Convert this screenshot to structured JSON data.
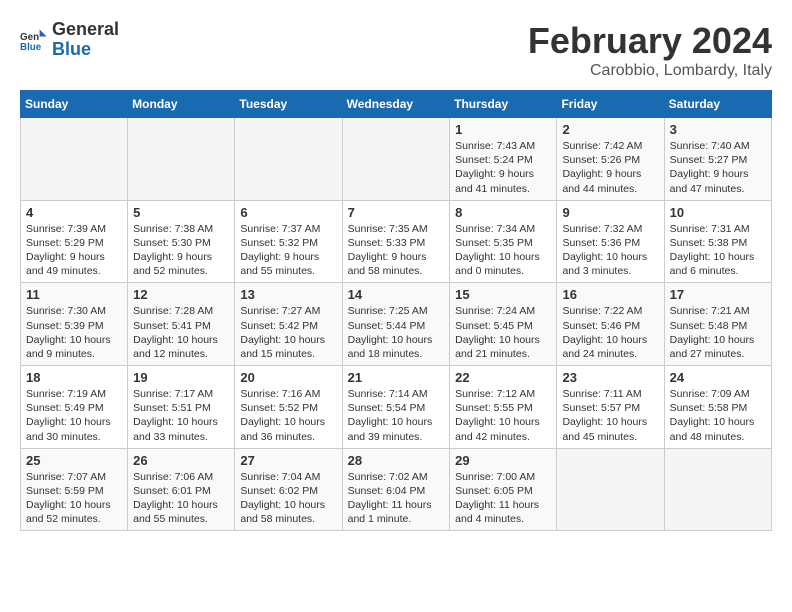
{
  "logo": {
    "line1": "General",
    "line2": "Blue"
  },
  "calendar": {
    "title": "February 2024",
    "subtitle": "Carobbio, Lombardy, Italy"
  },
  "headers": [
    "Sunday",
    "Monday",
    "Tuesday",
    "Wednesday",
    "Thursday",
    "Friday",
    "Saturday"
  ],
  "weeks": [
    [
      {
        "day": "",
        "info": ""
      },
      {
        "day": "",
        "info": ""
      },
      {
        "day": "",
        "info": ""
      },
      {
        "day": "",
        "info": ""
      },
      {
        "day": "1",
        "info": "Sunrise: 7:43 AM\nSunset: 5:24 PM\nDaylight: 9 hours\nand 41 minutes."
      },
      {
        "day": "2",
        "info": "Sunrise: 7:42 AM\nSunset: 5:26 PM\nDaylight: 9 hours\nand 44 minutes."
      },
      {
        "day": "3",
        "info": "Sunrise: 7:40 AM\nSunset: 5:27 PM\nDaylight: 9 hours\nand 47 minutes."
      }
    ],
    [
      {
        "day": "4",
        "info": "Sunrise: 7:39 AM\nSunset: 5:29 PM\nDaylight: 9 hours\nand 49 minutes."
      },
      {
        "day": "5",
        "info": "Sunrise: 7:38 AM\nSunset: 5:30 PM\nDaylight: 9 hours\nand 52 minutes."
      },
      {
        "day": "6",
        "info": "Sunrise: 7:37 AM\nSunset: 5:32 PM\nDaylight: 9 hours\nand 55 minutes."
      },
      {
        "day": "7",
        "info": "Sunrise: 7:35 AM\nSunset: 5:33 PM\nDaylight: 9 hours\nand 58 minutes."
      },
      {
        "day": "8",
        "info": "Sunrise: 7:34 AM\nSunset: 5:35 PM\nDaylight: 10 hours\nand 0 minutes."
      },
      {
        "day": "9",
        "info": "Sunrise: 7:32 AM\nSunset: 5:36 PM\nDaylight: 10 hours\nand 3 minutes."
      },
      {
        "day": "10",
        "info": "Sunrise: 7:31 AM\nSunset: 5:38 PM\nDaylight: 10 hours\nand 6 minutes."
      }
    ],
    [
      {
        "day": "11",
        "info": "Sunrise: 7:30 AM\nSunset: 5:39 PM\nDaylight: 10 hours\nand 9 minutes."
      },
      {
        "day": "12",
        "info": "Sunrise: 7:28 AM\nSunset: 5:41 PM\nDaylight: 10 hours\nand 12 minutes."
      },
      {
        "day": "13",
        "info": "Sunrise: 7:27 AM\nSunset: 5:42 PM\nDaylight: 10 hours\nand 15 minutes."
      },
      {
        "day": "14",
        "info": "Sunrise: 7:25 AM\nSunset: 5:44 PM\nDaylight: 10 hours\nand 18 minutes."
      },
      {
        "day": "15",
        "info": "Sunrise: 7:24 AM\nSunset: 5:45 PM\nDaylight: 10 hours\nand 21 minutes."
      },
      {
        "day": "16",
        "info": "Sunrise: 7:22 AM\nSunset: 5:46 PM\nDaylight: 10 hours\nand 24 minutes."
      },
      {
        "day": "17",
        "info": "Sunrise: 7:21 AM\nSunset: 5:48 PM\nDaylight: 10 hours\nand 27 minutes."
      }
    ],
    [
      {
        "day": "18",
        "info": "Sunrise: 7:19 AM\nSunset: 5:49 PM\nDaylight: 10 hours\nand 30 minutes."
      },
      {
        "day": "19",
        "info": "Sunrise: 7:17 AM\nSunset: 5:51 PM\nDaylight: 10 hours\nand 33 minutes."
      },
      {
        "day": "20",
        "info": "Sunrise: 7:16 AM\nSunset: 5:52 PM\nDaylight: 10 hours\nand 36 minutes."
      },
      {
        "day": "21",
        "info": "Sunrise: 7:14 AM\nSunset: 5:54 PM\nDaylight: 10 hours\nand 39 minutes."
      },
      {
        "day": "22",
        "info": "Sunrise: 7:12 AM\nSunset: 5:55 PM\nDaylight: 10 hours\nand 42 minutes."
      },
      {
        "day": "23",
        "info": "Sunrise: 7:11 AM\nSunset: 5:57 PM\nDaylight: 10 hours\nand 45 minutes."
      },
      {
        "day": "24",
        "info": "Sunrise: 7:09 AM\nSunset: 5:58 PM\nDaylight: 10 hours\nand 48 minutes."
      }
    ],
    [
      {
        "day": "25",
        "info": "Sunrise: 7:07 AM\nSunset: 5:59 PM\nDaylight: 10 hours\nand 52 minutes."
      },
      {
        "day": "26",
        "info": "Sunrise: 7:06 AM\nSunset: 6:01 PM\nDaylight: 10 hours\nand 55 minutes."
      },
      {
        "day": "27",
        "info": "Sunrise: 7:04 AM\nSunset: 6:02 PM\nDaylight: 10 hours\nand 58 minutes."
      },
      {
        "day": "28",
        "info": "Sunrise: 7:02 AM\nSunset: 6:04 PM\nDaylight: 11 hours\nand 1 minute."
      },
      {
        "day": "29",
        "info": "Sunrise: 7:00 AM\nSunset: 6:05 PM\nDaylight: 11 hours\nand 4 minutes."
      },
      {
        "day": "",
        "info": ""
      },
      {
        "day": "",
        "info": ""
      }
    ]
  ]
}
